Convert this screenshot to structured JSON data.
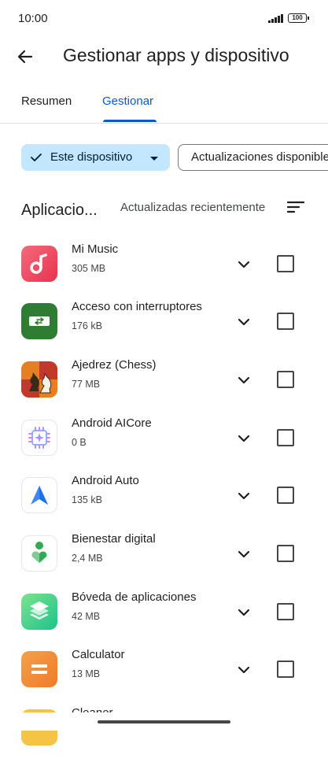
{
  "status_bar": {
    "time": "10:00",
    "battery": "100"
  },
  "header": {
    "title": "Gestionar apps y dispositivo"
  },
  "tabs": [
    {
      "label": "Resumen",
      "active": false
    },
    {
      "label": "Gestionar",
      "active": true
    }
  ],
  "filters": {
    "device_chip": "Este dispositivo",
    "updates_chip": "Actualizaciones disponibles"
  },
  "section": {
    "title": "Aplicacio...",
    "sort_label": "Actualizadas recientemente"
  },
  "apps": [
    {
      "name": "Mi Music",
      "size": "305 MB",
      "icon": "mi-music-icon"
    },
    {
      "name": "Acceso con interruptores",
      "size": "176 kB",
      "icon": "switch-access-icon"
    },
    {
      "name": "Ajedrez (Chess)",
      "size": "77 MB",
      "icon": "chess-icon"
    },
    {
      "name": "Android AICore",
      "size": "0 B",
      "icon": "aicore-icon"
    },
    {
      "name": "Android Auto",
      "size": "135 kB",
      "icon": "android-auto-icon"
    },
    {
      "name": "Bienestar digital",
      "size": "2,4 MB",
      "icon": "digital-wellbeing-icon"
    },
    {
      "name": "Bóveda de aplicaciones",
      "size": "42 MB",
      "icon": "app-vault-icon"
    },
    {
      "name": "Calculator",
      "size": "13 MB",
      "icon": "calculator-icon"
    },
    {
      "name": "Cleaner",
      "size": "",
      "icon": "cleaner-icon"
    }
  ],
  "colors": {
    "accent": "#0b57d0",
    "chip_selected_bg": "#c2e7ff"
  }
}
